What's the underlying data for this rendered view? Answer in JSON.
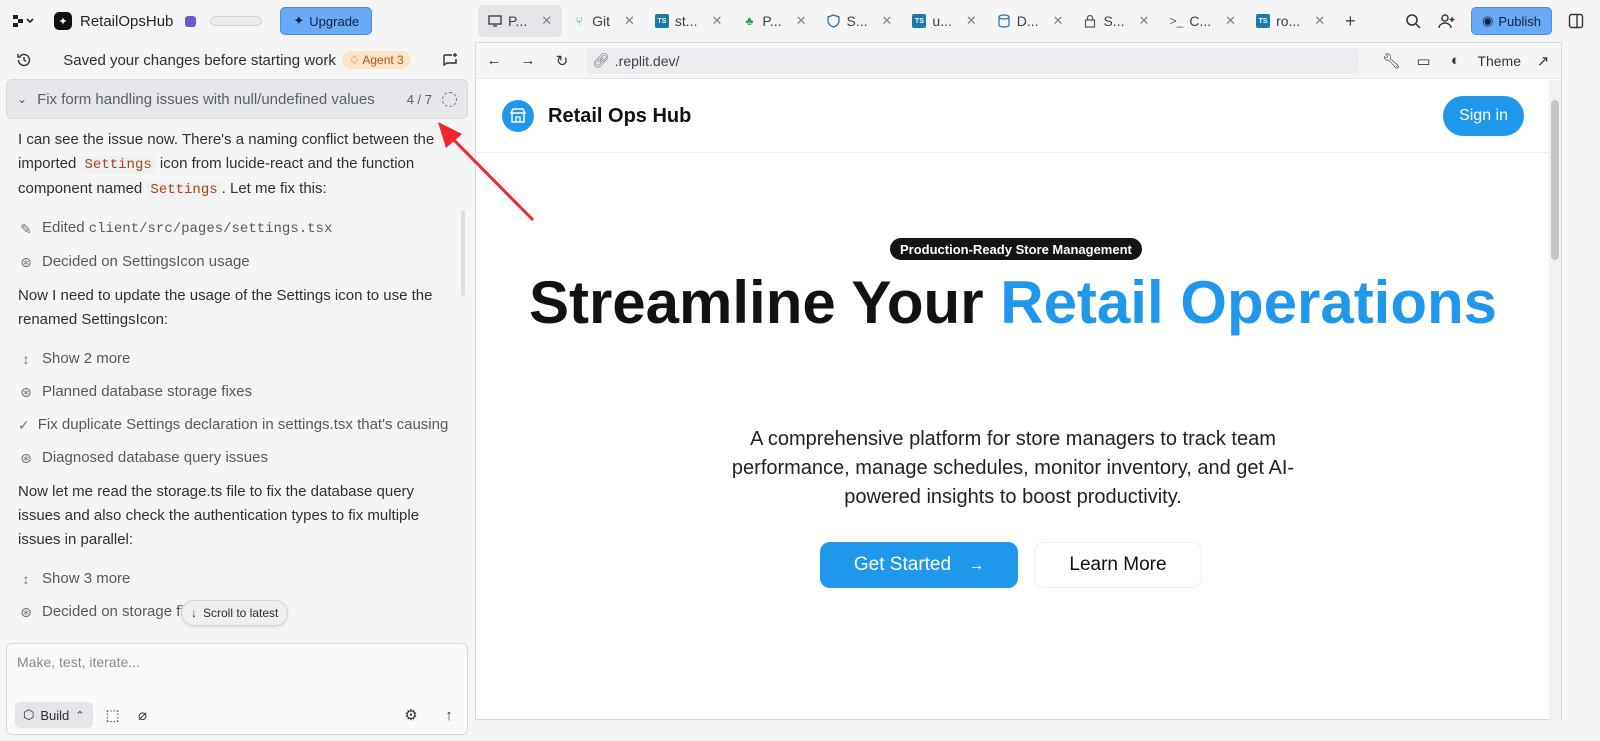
{
  "topbar": {
    "app_name": "RetailOpsHub",
    "upgrade_label": "Upgrade",
    "publish_label": "Publish",
    "tabs": [
      {
        "label": "P...",
        "icon": "monitor-icon"
      },
      {
        "label": "Git",
        "icon": "git-icon"
      },
      {
        "label": "st...",
        "icon": "typescript-icon"
      },
      {
        "label": "P...",
        "icon": "tree-icon"
      },
      {
        "label": "S...",
        "icon": "shield-icon"
      },
      {
        "label": "u...",
        "icon": "typescript-icon"
      },
      {
        "label": "D...",
        "icon": "database-icon"
      },
      {
        "label": "S...",
        "icon": "lock-icon"
      },
      {
        "label": "C...",
        "icon": "terminal-icon"
      },
      {
        "label": "ro...",
        "icon": "typescript-icon"
      }
    ]
  },
  "left_panel": {
    "status": "Saved your changes before starting work",
    "agent_badge": "Agent 3",
    "task": {
      "title": "Fix form handling issues with null/undefined values",
      "count": "4 / 7"
    },
    "feed": {
      "p1_a": "I can see the issue now. There's a naming conflict between the imported ",
      "p1_code1": "Settings",
      "p1_b": " icon from lucide-react and the function component named ",
      "p1_code2": "Settings",
      "p1_c": ". Let me fix this:",
      "edited_prefix": "Edited ",
      "edited_path": "client/src/pages/settings.tsx",
      "decided_1": "Decided on SettingsIcon usage",
      "p2": "Now I need to update the usage of the Settings icon to use the renamed SettingsIcon:",
      "show_more_1": "Show 2 more",
      "planned": "Planned database storage fixes",
      "fix_dup": "Fix duplicate Settings declaration in settings.tsx that's causing ...",
      "diagnosed": "Diagnosed database query issues",
      "p3": "Now let me read the storage.ts file to fix the database query issues and also check the authentication types to fix multiple issues in parallel:",
      "show_more_2": "Show 3 more",
      "decided_2": "Decided on storage file corrections"
    },
    "scroll_latest": "Scroll to latest",
    "composer": {
      "placeholder": "Make, test, iterate...",
      "build_label": "Build"
    }
  },
  "browser": {
    "url": ".replit.dev/",
    "theme_label": "Theme",
    "site": {
      "brand": "Retail Ops Hub",
      "sign_in": "Sign in",
      "badge": "Production-Ready Store Management",
      "title_part1": "Streamline Your ",
      "title_part2": "Retail Operations",
      "subtitle": "A comprehensive platform for store managers to track team performance, manage schedules, monitor inventory, and get AI-powered insights to boost productivity.",
      "cta_primary": "Get Started",
      "cta_secondary": "Learn More"
    }
  },
  "colors": {
    "accent": "#1f97ea",
    "upgrade": "#69a9f5",
    "annotation_arrow": "#f0262e"
  }
}
